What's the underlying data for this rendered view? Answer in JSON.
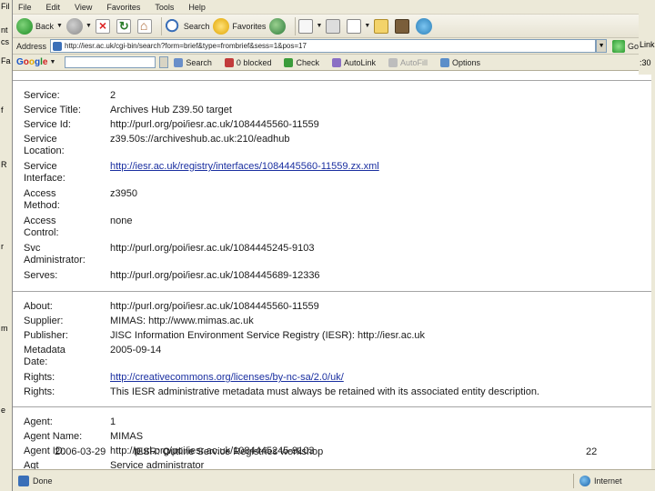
{
  "menu": [
    "File",
    "Edit",
    "View",
    "Favorites",
    "Tools",
    "Help"
  ],
  "background_window": {
    "left_labels": [
      "Fil",
      "nt",
      "cs",
      "Fa",
      "f",
      "R",
      "r",
      "m",
      "e"
    ],
    "right_labels": [
      "Link",
      ":30"
    ]
  },
  "toolbar": {
    "back_label": "Back",
    "search_label": "Search",
    "favorites_label": "Favorites"
  },
  "address": {
    "label": "Address",
    "url": "http://iesr.ac.uk/cgi-bin/search?form=brief&type=frombrief&sess=1&pos=17",
    "go_label": "Go"
  },
  "google_bar": {
    "logo": [
      "G",
      "o",
      "o",
      "g",
      "l",
      "e"
    ],
    "search_label": "Search",
    "blocked_label": "0 blocked",
    "check_label": "Check",
    "autolink_label": "AutoLink",
    "autofill_label": "AutoFill",
    "options_label": "Options"
  },
  "record": {
    "service_section": [
      {
        "label": "Service:",
        "value": "2"
      },
      {
        "label": "Service Title:",
        "value": "Archives Hub Z39.50 target"
      },
      {
        "label": "Service Id:",
        "value": "http://purl.org/poi/iesr.ac.uk/1084445560-11559"
      },
      {
        "label": "Service Location:",
        "value": "z39.50s://archiveshub.ac.uk:210/eadhub"
      },
      {
        "label": "Service Interface:",
        "value": "http://iesr.ac.uk/registry/interfaces/1084445560-11559.zx.xml",
        "link": true
      },
      {
        "label": "Access Method:",
        "value": "z3950"
      },
      {
        "label": "Access Control:",
        "value": "none"
      },
      {
        "label": "Svc Administrator:",
        "value": "http://purl.org/poi/iesr.ac.uk/1084445245-9103"
      },
      {
        "label": "Serves:",
        "value": "http://purl.org/poi/iesr.ac.uk/1084445689-12336"
      }
    ],
    "about_section": [
      {
        "label": "About:",
        "value": "http://purl.org/poi/iesr.ac.uk/1084445560-11559"
      },
      {
        "label": "Supplier:",
        "value": "MIMAS: http://www.mimas.ac.uk"
      },
      {
        "label": "Publisher:",
        "value": "JISC Information Environment Service Registry (IESR): http://iesr.ac.uk"
      },
      {
        "label": "Metadata Date:",
        "value": "2005-09-14"
      },
      {
        "label": "Rights:",
        "value": "http://creativecommons.org/licenses/by-nc-sa/2.0/uk/",
        "link": true
      },
      {
        "label": "Rights:",
        "value": "This IESR administrative metadata must always be retained with its associated entity description."
      }
    ],
    "agent_section": [
      {
        "label": "Agent:",
        "value": "1"
      },
      {
        "label": "Agent Name:",
        "value": "MIMAS"
      },
      {
        "label": "Agent ID:",
        "value": "http://purl.org/poi/iesr.ac.uk/1084445245-9103"
      },
      {
        "label": "Agt",
        "value": "Service administrator"
      }
    ]
  },
  "slide": {
    "footer": "2006-03-29          IESR: Outline Service Registries workshop",
    "page_number": "22"
  },
  "status": {
    "text": "Done",
    "zone": "Internet"
  }
}
